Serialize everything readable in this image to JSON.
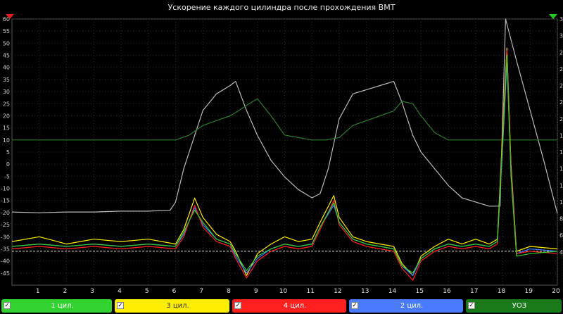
{
  "chart_data": {
    "type": "line",
    "title": "Ускорение каждого цилиндра после прохождения ВМТ",
    "xlim": [
      0,
      20
    ],
    "ylim": [
      -50,
      60
    ],
    "y2lim": [
      0,
      32
    ],
    "x_ticks": [
      1,
      2,
      3,
      4,
      5,
      6,
      7,
      8,
      9,
      10,
      11,
      12,
      13,
      14,
      15,
      16,
      17,
      18,
      19,
      20
    ],
    "y_ticks": [
      60,
      55,
      50,
      45,
      40,
      35,
      30,
      25,
      20,
      15,
      10,
      5,
      0,
      -5,
      -10,
      -15,
      -20,
      -25,
      -30,
      -35,
      -40,
      -45
    ],
    "y2_ticks": [
      32,
      30,
      28,
      26,
      24,
      22,
      20,
      18,
      16,
      14,
      12,
      10,
      8,
      6,
      4
    ],
    "reference_line": -36,
    "grid": true,
    "series": [
      {
        "name": "1 цил.",
        "color": "#33cc33",
        "x": [
          0,
          1,
          2,
          3,
          4,
          5,
          6,
          6.3,
          6.7,
          7,
          7.5,
          8,
          8.2,
          8.6,
          9,
          9.5,
          10,
          10.5,
          11,
          11.3,
          11.8,
          12,
          12.5,
          13,
          13.5,
          14,
          14.3,
          14.7,
          15,
          15.5,
          16,
          16.5,
          17,
          17.5,
          17.8,
          18,
          18.15,
          18.3,
          18.5,
          19,
          20
        ],
        "y": [
          -34,
          -33,
          -34,
          -33,
          -34,
          -33,
          -34,
          -28,
          -19,
          -24,
          -31,
          -33,
          -37,
          -44,
          -38,
          -35,
          -33,
          -34,
          -33,
          -26,
          -16,
          -24,
          -31,
          -33,
          -34,
          -35,
          -42,
          -45,
          -39,
          -35,
          -33,
          -34,
          -33,
          -34,
          -32,
          10,
          45,
          -5,
          -38,
          -37,
          -36
        ]
      },
      {
        "name": "3 цил.",
        "color": "#ffee00",
        "x": [
          0,
          1,
          2,
          3,
          4,
          5,
          6,
          6.3,
          6.7,
          7,
          7.5,
          8,
          8.2,
          8.6,
          9,
          9.5,
          10,
          10.5,
          11,
          11.3,
          11.8,
          12,
          12.5,
          13,
          13.5,
          14,
          14.3,
          14.7,
          15,
          15.5,
          16,
          16.5,
          17,
          17.5,
          17.8,
          18,
          18.15,
          18.3,
          18.5,
          19,
          20
        ],
        "y": [
          -32,
          -30,
          -33,
          -31,
          -32,
          -31,
          -33,
          -27,
          -14,
          -22,
          -29,
          -32,
          -36,
          -46,
          -37,
          -33,
          -30,
          -32,
          -31,
          -24,
          -13,
          -22,
          -30,
          -32,
          -33,
          -34,
          -41,
          -46,
          -38,
          -34,
          -31,
          -33,
          -31,
          -33,
          -31,
          15,
          48,
          0,
          -36,
          -34,
          -35
        ]
      },
      {
        "name": "4 цил.",
        "color": "#ff2222",
        "x": [
          0,
          1,
          2,
          3,
          4,
          5,
          6,
          6.3,
          6.7,
          7,
          7.5,
          8,
          8.2,
          8.6,
          9,
          9.5,
          10,
          10.5,
          11,
          11.3,
          11.8,
          12,
          12.5,
          13,
          13.5,
          14,
          14.3,
          14.7,
          15,
          15.5,
          16,
          16.5,
          17,
          17.5,
          17.8,
          18,
          18.15,
          18.3,
          18.5,
          19,
          20
        ],
        "y": [
          -35,
          -34,
          -35,
          -34,
          -35,
          -34,
          -35,
          -30,
          -17,
          -26,
          -32,
          -34,
          -39,
          -47,
          -40,
          -36,
          -34,
          -35,
          -34,
          -27,
          -15,
          -25,
          -32,
          -34,
          -35,
          -36,
          -43,
          -48,
          -40,
          -36,
          -34,
          -35,
          -34,
          -35,
          -33,
          12,
          47,
          -3,
          -37,
          -36,
          -37
        ]
      },
      {
        "name": "2 цил.",
        "color": "#4477ff",
        "x": [
          0,
          1,
          2,
          3,
          4,
          5,
          6,
          6.3,
          6.7,
          7,
          7.5,
          8,
          8.2,
          8.6,
          9,
          9.5,
          10,
          10.5,
          11,
          11.3,
          11.8,
          12,
          12.5,
          13,
          13.5,
          14,
          14.3,
          14.7,
          15,
          15.5,
          16,
          16.5,
          17,
          17.5,
          17.8,
          18,
          18.15,
          18.3,
          18.5,
          19,
          20
        ],
        "y": [
          -34,
          -33,
          -34,
          -33,
          -34,
          -33,
          -34,
          -29,
          -18,
          -25,
          -31,
          -33,
          -38,
          -45,
          -39,
          -35,
          -33,
          -34,
          -33,
          -26,
          -17,
          -24,
          -31,
          -33,
          -34,
          -35,
          -42,
          -46,
          -39,
          -35,
          -33,
          -34,
          -33,
          -34,
          -32,
          8,
          42,
          -2,
          -37,
          -35,
          -36
        ]
      },
      {
        "name": "УОЗ",
        "color": "#2f7a2f",
        "x": [
          0,
          0.5,
          1,
          1.5,
          2,
          2.5,
          3,
          3.5,
          4,
          4.5,
          5,
          5.5,
          6,
          6.5,
          7,
          7.5,
          8,
          8.3,
          8.7,
          9,
          9.5,
          10,
          10.5,
          11,
          11.5,
          12,
          12.5,
          13,
          13.5,
          14,
          14.3,
          14.7,
          15,
          15.5,
          16,
          16.5,
          17,
          17.5,
          18,
          18.5,
          19,
          19.5,
          20
        ],
        "y": [
          10,
          10,
          10,
          10,
          10,
          10,
          10,
          10,
          10,
          10,
          10,
          10,
          10,
          12,
          16,
          18,
          20,
          22,
          25,
          27,
          20,
          12,
          11,
          10,
          10,
          11,
          16,
          18,
          20,
          22,
          26,
          25,
          20,
          13,
          10,
          10,
          10,
          10,
          10,
          10,
          10,
          10,
          10
        ]
      },
      {
        "name": "",
        "color": "#bbbbbb",
        "axis": "right",
        "x": [
          0,
          1,
          2,
          3,
          4,
          5,
          5.8,
          6,
          6.3,
          6.7,
          7,
          7.5,
          8,
          8.2,
          8.6,
          9,
          9.5,
          10,
          10.5,
          11,
          11.3,
          11.6,
          12,
          12.5,
          13,
          13.5,
          14,
          14.3,
          14.7,
          15,
          15.5,
          16,
          16.5,
          17,
          17.5,
          17.9,
          18.1,
          18.5,
          19,
          19.5,
          20
        ],
        "y": [
          8.8,
          8.7,
          8.8,
          8.8,
          8.9,
          8.9,
          9.0,
          10,
          14,
          18,
          21,
          23,
          24,
          24.5,
          21,
          18,
          15,
          13,
          11.5,
          10.5,
          11,
          14,
          20,
          23,
          23.5,
          24,
          24.5,
          22,
          18,
          16,
          14,
          12,
          10.5,
          10,
          9.5,
          9.5,
          32,
          27,
          21,
          15,
          8.6
        ]
      }
    ]
  },
  "legend": [
    {
      "label": "1 цил.",
      "bg": "#33d233",
      "fg": "#ffffff"
    },
    {
      "label": "3 цил.",
      "bg": "#ffee00",
      "fg": "#333333"
    },
    {
      "label": "4 цил.",
      "bg": "#ff2020",
      "fg": "#ffffff"
    },
    {
      "label": "2 цил.",
      "bg": "#4a7bff",
      "fg": "#ffffff"
    },
    {
      "label": "УОЗ",
      "bg": "#1a7a1a",
      "fg": "#ffffff"
    }
  ],
  "checkmark": "✓"
}
